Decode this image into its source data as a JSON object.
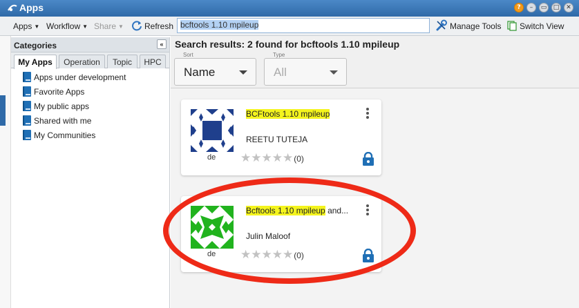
{
  "window": {
    "title": "Apps"
  },
  "toolbar": {
    "apps_label": "Apps",
    "workflow_label": "Workflow",
    "share_label": "Share",
    "refresh_label": "Refresh",
    "search_value": "bcftools 1.10 mpileup",
    "manage_tools_label": "Manage Tools",
    "switch_view_label": "Switch View"
  },
  "categories": {
    "title": "Categories",
    "tabs": [
      {
        "label": "My Apps",
        "active": true
      },
      {
        "label": "Operation",
        "active": false
      },
      {
        "label": "Topic",
        "active": false
      },
      {
        "label": "HPC",
        "active": false
      }
    ],
    "items": [
      {
        "label": "Apps under development"
      },
      {
        "label": "Favorite Apps"
      },
      {
        "label": "My public apps"
      },
      {
        "label": "Shared with me"
      },
      {
        "label": "My Communities"
      }
    ]
  },
  "results": {
    "title": "Search results: 2 found for bcftools 1.10 mpileup",
    "sort": {
      "label": "Sort",
      "value": "Name"
    },
    "type": {
      "label": "Type",
      "value": "All"
    },
    "cards": [
      {
        "name": "BCFtools 1.10 mpileup",
        "name_suffix": "",
        "author": "REETU TUTEJA",
        "badge": "de",
        "rating": "(0)",
        "icon_color": "#1f3f8c"
      },
      {
        "name": "Bcftools 1.10 mpileup",
        "name_suffix": " and...",
        "author": "Julin Maloof",
        "badge": "de",
        "rating": "(0)",
        "icon_color": "#21b31e"
      }
    ]
  },
  "colors": {
    "highlight": "#f4f41d",
    "annotation": "#ee2a17",
    "accent": "#1f6fb5"
  }
}
